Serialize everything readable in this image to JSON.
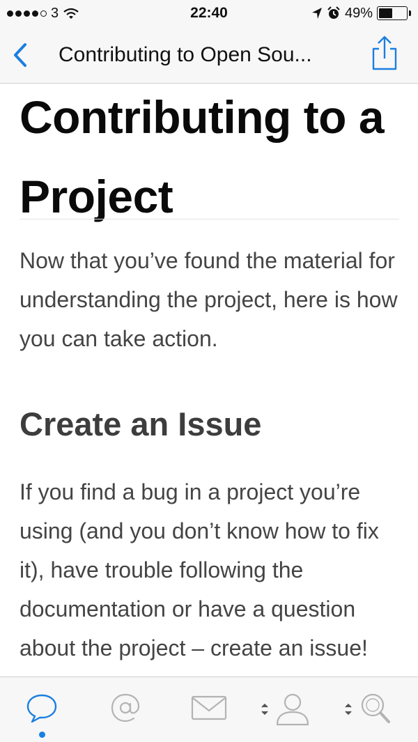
{
  "status": {
    "carrier": "3",
    "time": "22:40",
    "battery": "49%",
    "battery_level": 0.49
  },
  "nav": {
    "title": "Contributing to Open Sou..."
  },
  "article": {
    "heading": "Contributing to a Project",
    "intro": "Now that you’ve found the material for understanding the project, here is how you can take action.",
    "section_heading": "Create an Issue",
    "section_text": "If you find a bug in a project you’re using (and you don’t know how to fix it), have trouble following the documentation or have a question about the project – create an issue!"
  },
  "tabs": [
    {
      "icon": "chat-bubble-icon",
      "active": true
    },
    {
      "icon": "at-sign-icon",
      "active": false
    },
    {
      "icon": "envelope-icon",
      "active": false
    },
    {
      "icon": "person-icon",
      "active": false
    },
    {
      "icon": "search-icon",
      "active": false
    }
  ],
  "colors": {
    "accent": "#1a7fe0",
    "inactive_icon": "#b3b3b3"
  }
}
